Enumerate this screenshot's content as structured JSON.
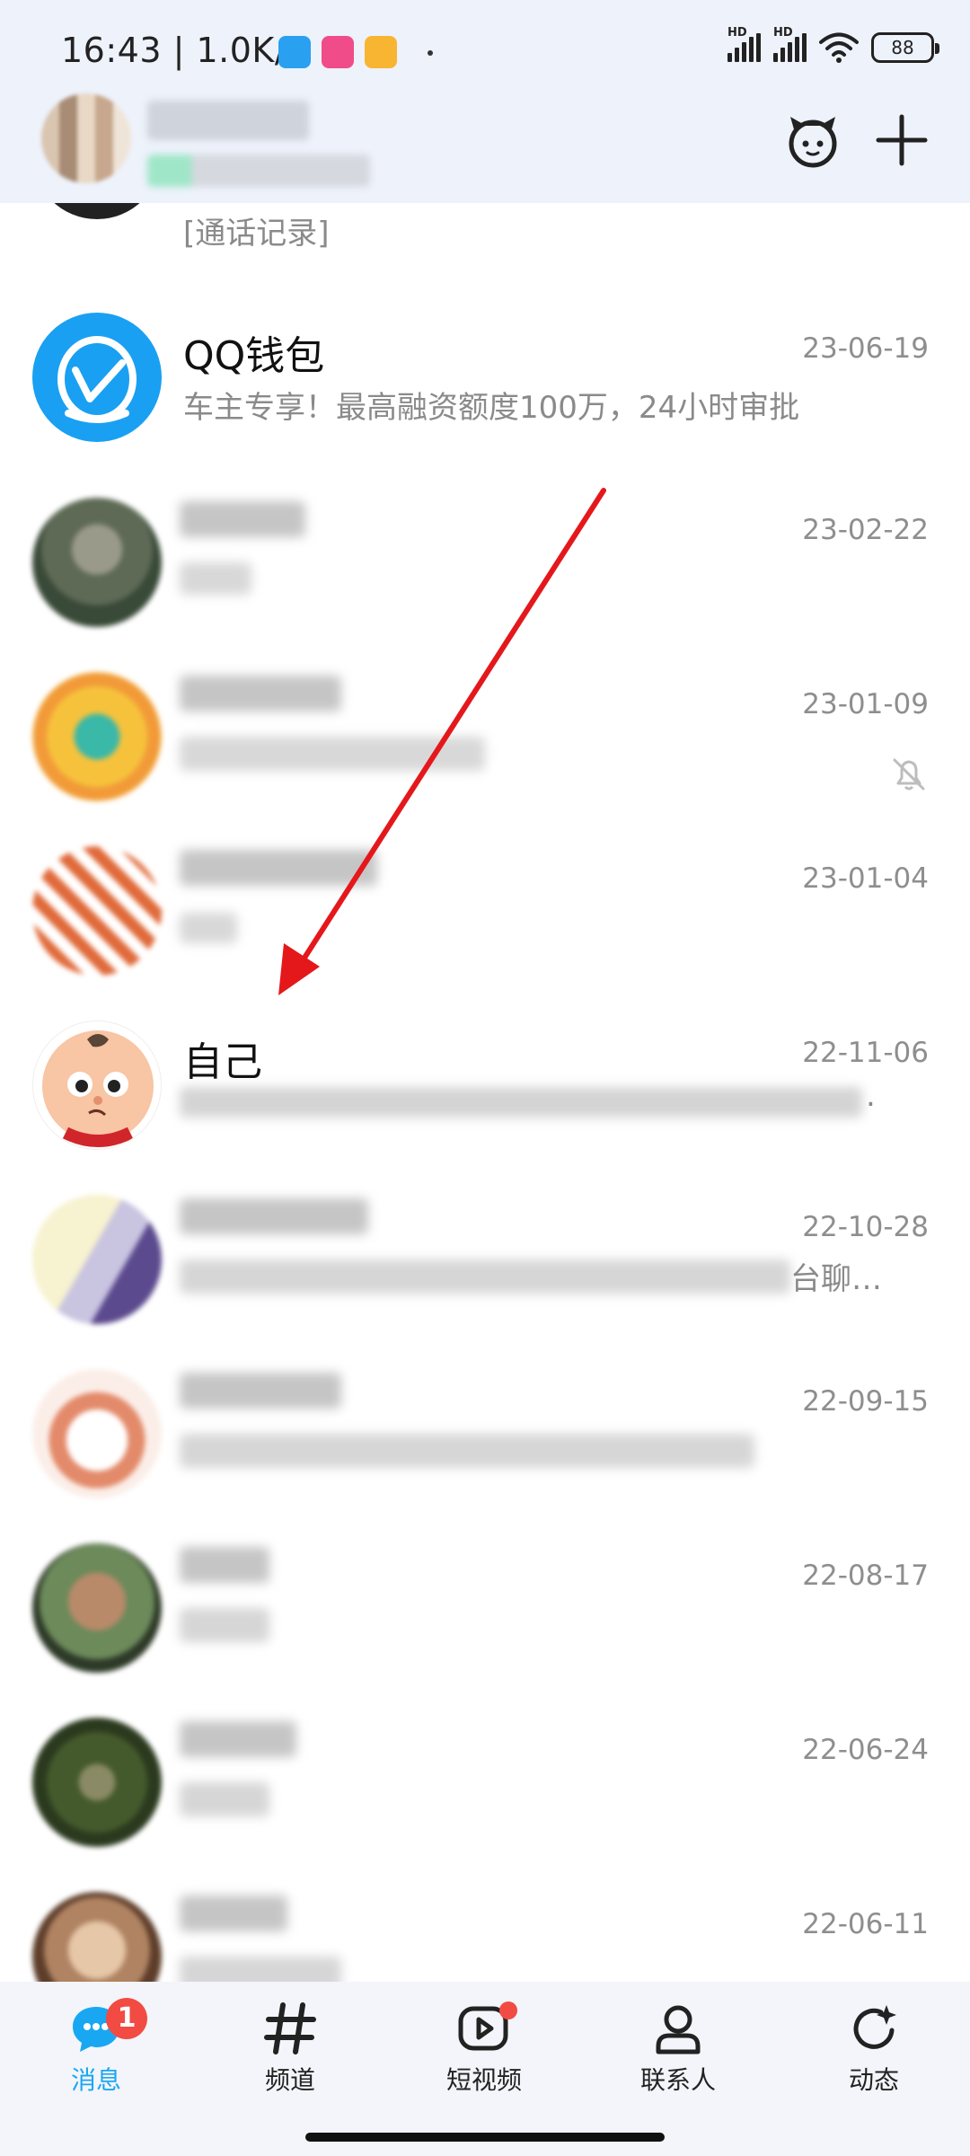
{
  "status_bar": {
    "time": "16:43 | 1.0K/s",
    "battery": "88",
    "network_labels": [
      "HD",
      "HD"
    ]
  },
  "header": {
    "icons": [
      "mascot-icon",
      "plus-icon"
    ]
  },
  "chats": [
    {
      "name": "",
      "preview": "[通话记录]",
      "time": "",
      "blurred": true
    },
    {
      "name": "QQ钱包",
      "preview": "车主专享！最高融资额度100万，24小时审批",
      "time": "23-06-19",
      "avatar_color": "#1aa0f2"
    },
    {
      "name": "",
      "preview": "",
      "time": "23-02-22",
      "blurred": true
    },
    {
      "name": "",
      "preview": "",
      "time": "23-01-09",
      "blurred": true,
      "muted": true
    },
    {
      "name": "",
      "preview": "",
      "time": "23-01-04",
      "blurred": true
    },
    {
      "name": "自己",
      "preview": "",
      "time": "22-11-06",
      "preview_suffix": "."
    },
    {
      "name": "",
      "preview": "",
      "time": "22-10-28",
      "blurred": true,
      "preview_suffix": "台聊…"
    },
    {
      "name": "",
      "preview": "",
      "time": "22-09-15",
      "blurred": true
    },
    {
      "name": "",
      "preview": "",
      "time": "22-08-17",
      "blurred": true
    },
    {
      "name": "",
      "preview": "",
      "time": "22-06-24",
      "blurred": true
    },
    {
      "name": "",
      "preview": "",
      "time": "22-06-11",
      "blurred": true
    }
  ],
  "nav": {
    "tabs": [
      {
        "label": "消息",
        "icon": "chat-bubble-icon",
        "active": true,
        "badge": "1"
      },
      {
        "label": "频道",
        "icon": "hash-icon"
      },
      {
        "label": "短视频",
        "icon": "video-play-icon",
        "dot": true
      },
      {
        "label": "联系人",
        "icon": "person-icon"
      },
      {
        "label": "动态",
        "icon": "refresh-star-icon"
      }
    ]
  },
  "colors": {
    "accent": "#1aa7f2",
    "badge": "#f24b43",
    "arrow": "#e4181b",
    "header_bg": "#eef2fb"
  }
}
